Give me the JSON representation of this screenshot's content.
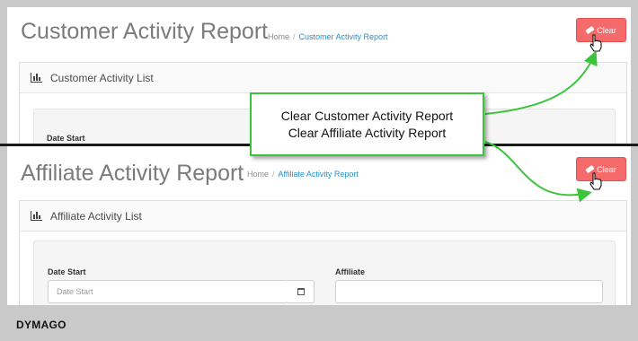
{
  "customer_report": {
    "title": "Customer Activity Report",
    "breadcrumb": [
      "Home",
      "Customer Activity Report"
    ],
    "clear_label": "Clear",
    "panel_title": "Customer Activity List",
    "date_start_label": "Date Start"
  },
  "affiliate_report": {
    "title": "Affiliate Activity Report",
    "breadcrumb": [
      "Home",
      "Affiliate Activity Report"
    ],
    "clear_label": "Clear",
    "panel_title": "Affiliate Activity List",
    "date_start_label": "Date Start",
    "date_start_placeholder": "Date Start",
    "affiliate_label": "Affiliate",
    "affiliate_value": ""
  },
  "callout": {
    "line1": "Clear Customer Activity Report",
    "line2": "Clear Affiliate Activity Report"
  },
  "brand": "DYMAGO",
  "colors": {
    "clear_button": "#f56b6b",
    "callout_border": "#3dc43d",
    "link": "#1e91cf"
  }
}
